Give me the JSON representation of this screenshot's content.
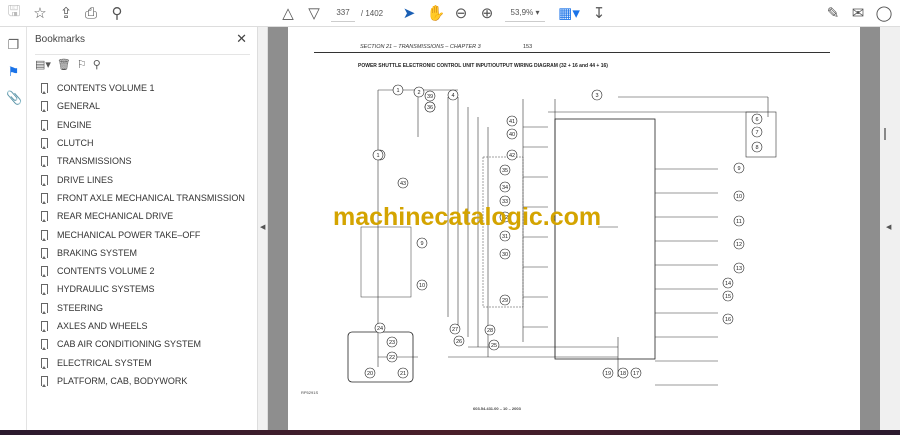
{
  "toolbar": {
    "page_current": "337",
    "page_total": "/ 1402",
    "zoom": "53,9%"
  },
  "panel": {
    "title": "Bookmarks",
    "items": [
      {
        "label": "CONTENTS VOLUME 1"
      },
      {
        "label": "GENERAL"
      },
      {
        "label": "ENGINE"
      },
      {
        "label": "CLUTCH"
      },
      {
        "label": "TRANSMISSIONS"
      },
      {
        "label": "DRIVE LINES"
      },
      {
        "label": "FRONT AXLE MECHANICAL TRANSMISSION"
      },
      {
        "label": "REAR MECHANICAL DRIVE"
      },
      {
        "label": "MECHANICAL POWER TAKE–OFF"
      },
      {
        "label": "BRAKING SYSTEM"
      },
      {
        "label": "CONTENTS VOLUME 2"
      },
      {
        "label": "HYDRAULIC SYSTEMS"
      },
      {
        "label": "STEERING"
      },
      {
        "label": "AXLES AND WHEELS"
      },
      {
        "label": "CAB AIR CONDITIONING SYSTEM"
      },
      {
        "label": "ELECTRICAL SYSTEM"
      },
      {
        "label": "PLATFORM, CAB, BODYWORK"
      }
    ]
  },
  "document": {
    "section_header": "SECTION 21 – TRANSMISSIONS – CHAPTER 3",
    "page_number": "153",
    "diagram_title": "POWER SHUTTLE ELECTRONIC CONTROL UNIT INPUT/OUTPUT WIRING DIAGRAM (32 + 16 and 44 + 16)",
    "figure_ref": "RP5291S",
    "footer": "603.54.431.00 – 10 – 2003",
    "watermark": "machinecatalogic.com",
    "callouts": [
      "1",
      "2",
      "3",
      "4",
      "39",
      "38",
      "36",
      "41",
      "40",
      "42",
      "35",
      "34",
      "33",
      "32",
      "31",
      "30",
      "29",
      "28",
      "27",
      "26",
      "25",
      "24",
      "23",
      "22",
      "21",
      "20",
      "37",
      "43",
      "9",
      "10",
      "6",
      "7",
      "8",
      "9",
      "10",
      "11",
      "12",
      "13",
      "14",
      "15",
      "16",
      "17",
      "18",
      "19",
      "1"
    ]
  },
  "colors": {
    "watermark": "#d4a400",
    "accent": "#1a73e8",
    "viewer_bg": "#8e8e8e"
  }
}
